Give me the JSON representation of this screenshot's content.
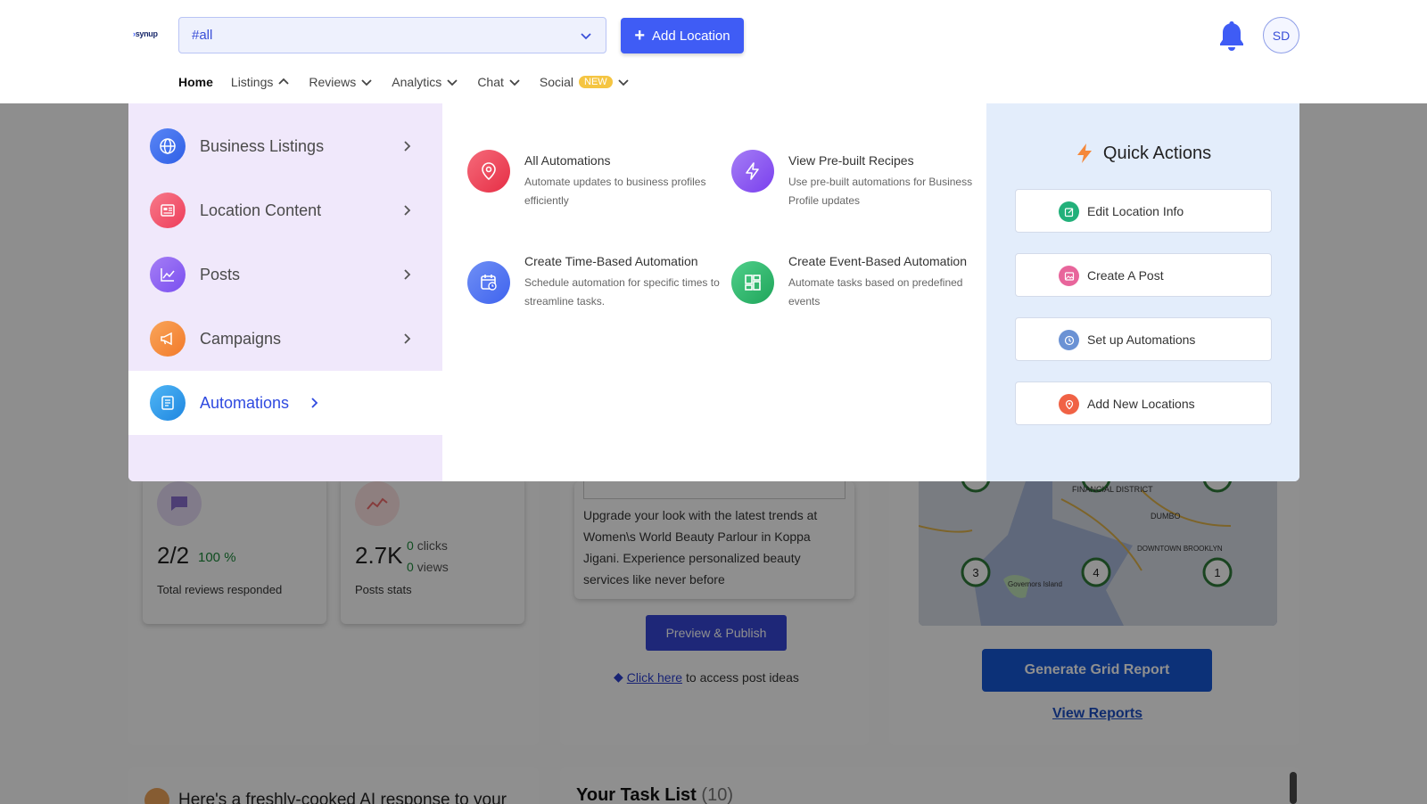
{
  "logo": {
    "text": "synup"
  },
  "header": {
    "location_select": {
      "value": "#all"
    },
    "add_location_label": "Add Location",
    "avatar_initials": "SD"
  },
  "nav": {
    "items": [
      {
        "label": "Home"
      },
      {
        "label": "Listings"
      },
      {
        "label": "Reviews"
      },
      {
        "label": "Analytics"
      },
      {
        "label": "Chat"
      },
      {
        "label": "Social"
      }
    ],
    "social_badge": "NEW"
  },
  "mega_menu": {
    "side_items": [
      {
        "label": "Business Listings",
        "icon": "globe-icon",
        "color": "#3b6df0"
      },
      {
        "label": "Location Content",
        "icon": "newspaper-icon",
        "color": "#f0506e"
      },
      {
        "label": "Posts",
        "icon": "chart-line-icon",
        "color": "#8a5cf0"
      },
      {
        "label": "Campaigns",
        "icon": "megaphone-icon",
        "color": "#f5883a"
      },
      {
        "label": "Automations",
        "icon": "document-icon",
        "color": "#2a9be6"
      }
    ],
    "active_item": "Automations",
    "automations": [
      {
        "title": "All Automations",
        "desc": "Automate updates to business profiles efficiently",
        "color": "#ee3d52"
      },
      {
        "title": "View Pre-built Recipes",
        "desc": "Use pre-built automations for Business Profile updates",
        "color": "#8249ee"
      },
      {
        "title": "Create Time-Based Automation",
        "desc": "Schedule automation for specific times to streamline tasks.",
        "color": "#4a6ff0"
      },
      {
        "title": "Create Event-Based Automation",
        "desc": "Automate tasks based on predefined events",
        "color": "#2db36a"
      }
    ],
    "quick_actions": {
      "title": "Quick Actions",
      "items": [
        {
          "label": "Edit Location Info",
          "color": "#22b07a"
        },
        {
          "label": "Create A Post",
          "color": "#e8659b"
        },
        {
          "label": "Set up Automations",
          "color": "#6b92d4"
        },
        {
          "label": "Add New Locations",
          "color": "#f06245"
        }
      ]
    }
  },
  "dashboard": {
    "reviews": {
      "value": "2/2",
      "pct": "100 %",
      "label": "Total reviews responded"
    },
    "posts": {
      "value": "2.7K",
      "clicks_num": "0",
      "clicks_label": "clicks",
      "views_num": "0",
      "views_label": "views",
      "label": "Posts stats"
    },
    "post_text": "Upgrade your look with the latest trends at Women\\s World Beauty Parlour in Koppa Jigani. Experience personalized beauty services like never before",
    "preview_label": "Preview & Publish",
    "click_here": "Click here",
    "click_here_rest": "to access post ideas",
    "grid_button": "Generate Grid Report",
    "view_reports": "View Reports",
    "ai_text": "Here's a freshly-cooked AI response to your",
    "task_title": "Your Task List",
    "task_count": "(10)",
    "map_labels": {
      "financial": "FINANCIAL DISTRICT",
      "dumbo": "DUMBO",
      "downtown": "DOWNTOWN BROOKLYN",
      "governors": "Governors Island",
      "markers": [
        "3",
        "4",
        "1"
      ]
    }
  }
}
